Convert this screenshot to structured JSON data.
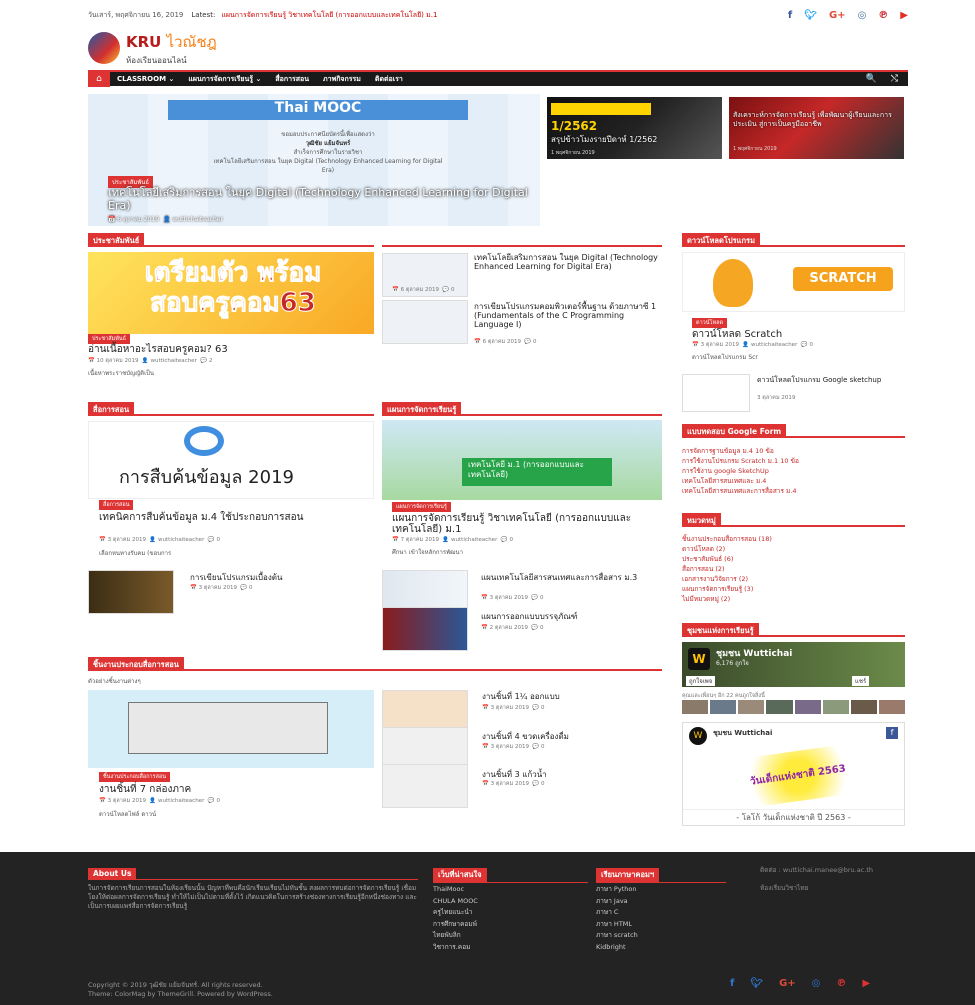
{
  "topbar": {
    "date": "วันเสาร์, พฤศจิกายน 16, 2019",
    "latest_label": "Latest:",
    "latest_text": "แผนการจัดการเรียนรู้ วิชาเทคโนโลยี (การออกแบบและเทคโนโลยี) ม.1",
    "social": [
      "f",
      "t",
      "G+",
      "ig",
      "p",
      "yt"
    ]
  },
  "logo": {
    "kru": "KRU",
    "script": "ไวณัชฎ",
    "sub": "ห้องเรียนออนไลน์"
  },
  "nav": {
    "items": [
      "CLASSROOM ⌄",
      "แผนการจัดการเรียนรู้ ⌄",
      "สื่อการสอน",
      "ภาพกิจกรรม",
      "ติดต่อเรา"
    ],
    "search": "🔍",
    "random": "⤭"
  },
  "featured": {
    "banner": "Thai MOOC",
    "lines": [
      "ขอมอบประกาศนียบัตรนี้เพื่อแสดงว่า",
      "วุฒิชัย แย้มจันทร์",
      "สำเร็จการศึกษาในรายวิชา",
      "เทคโนโลยีเสริมการสอน ในยุค Digital (Technology Enhanced Learning for Digital Era)"
    ],
    "cat": "ประชาสัมพันธ์",
    "title": "เทคโนโลยีเสริมการสอน ในยุค Digital (Technology Enhanced Learning for Digital Era)",
    "date": "6 ตุลาคม 2019",
    "author": "wuttichaiteacher"
  },
  "featured_small": [
    {
      "title": "สรุปข้าวโมงรายปีดาห์ 1/2562",
      "date": "1 พฤศจิกายน 2019"
    },
    {
      "title": "สังเคราะห์การจัดการเรียนรู้ เพื่อพัฒนาผู้เรียนและการประเมิน สู่การเป็นครูมืออาชีพ",
      "date": "1 พฤศจิกายน 2019"
    }
  ],
  "sections": {
    "pr": {
      "title": "ประชาสัมพันธ์",
      "main": {
        "img_text": "เตรียมตัว พร้อม สอบครูคอม63",
        "cat": "ประชาสัมพันธ์",
        "title": "อ่านเนื้อหาอะไรสอบครูคอม? 63",
        "date": "10 ตุลาคม 2019",
        "author": "wuttichaiteacher",
        "comments": "2",
        "excerpt": "เนื้อหาพระราชบัญญัติเป็น"
      },
      "list": [
        {
          "title": "เทคโนโลยีเสริมการสอน ในยุค Digital (Technology Enhanced Learning for Digital Era)",
          "date": "6 ตุลาคม 2019",
          "c": "0"
        },
        {
          "title": "การเขียนโปรแกรมคอมพิวเตอร์พื้นฐาน ด้วยภาษาซี 1 (Fundamentals of the C Programming Language I)",
          "date": "6 ตุลาคม 2019",
          "c": "0"
        }
      ]
    },
    "media": {
      "title": "สื่อการสอน",
      "main": {
        "img_text": "การสืบค้นข้อมูล 2019",
        "cat": "สื่อการสอน",
        "title": "เทคนิคการสืบค้นข้อมูล ม.4 ใช้ประกอบการสอน",
        "date": "3 ตุลาคม 2019",
        "author": "wuttichaiteacher",
        "comments": "0",
        "excerpt": "เลือกหนทางรับคม (ขอบการ"
      },
      "list": [
        {
          "title": "การเขียนโปรแกรมเบื้องต้น",
          "date": "3 ตุลาคม 2019",
          "c": "0"
        }
      ]
    },
    "plan": {
      "title": "แผนการจัดการเรียนรู้",
      "main": {
        "img_text": "เทคโนโลยี ม.1 (การออกแบบและเทคโนโลยี)",
        "cat": "แผนการจัดการเรียนรู้",
        "title": "แผนการจัดการเรียนรู้ วิชาเทคโนโลยี (การออกแบบและเทคโนโลยี) ม.1",
        "date": "7 ตุลาคม 2019",
        "author": "wuttichaiteacher",
        "comments": "0",
        "excerpt": "ศึกษา เข้าใจหลักการพัฒนา"
      },
      "list": [
        {
          "title": "แผนเทคโนโลยีสารสนเทศและการสื่อสาร ม.3",
          "date": "3 ตุลาคม 2019",
          "c": "0"
        },
        {
          "title": "แผนการออกแบบบรรจุภัณฑ์",
          "date": "2 ตุลาคม 2019",
          "c": "0"
        }
      ]
    },
    "works": {
      "title": "ชิ้นงานประกอบสื่อการสอน",
      "intro": "ตัวอย่างชิ้นงานต่างๆ",
      "main": {
        "cat": "ชิ้นงานประกอบสื่อการสอน",
        "title": "งานชิ้นที่ 7 กล่องภาค",
        "date": "3 ตุลาคม 2019",
        "author": "wuttichaiteacher",
        "comments": "0",
        "excerpt": "ดาวน์โหลดไฟล์ ดาวน์"
      },
      "list": [
        {
          "title": "งานชิ้นที่ 1¼ ออกแบบ",
          "date": "3 ตุลาคม 2019",
          "c": "0"
        },
        {
          "title": "งานชิ้นที่ 4 ขวดเครื่องดื่ม",
          "date": "3 ตุลาคม 2019",
          "c": "0"
        },
        {
          "title": "งานชิ้นที่ 3 แก้วน้ำ",
          "date": "3 ตุลาคม 2019",
          "c": "0"
        }
      ]
    }
  },
  "sidebar": {
    "download": {
      "title": "ดาวน์โหลดโปรแกรม",
      "img_text": "SCRATCH",
      "cat": "ดาวน์โหลด",
      "post": "ดาวน์โหลด Scratch",
      "date": "3 ตุลาคม 2019",
      "author": "wuttichaiteacher",
      "comments": "0",
      "excerpt": "ดาวน์โหลดโปรแกรม Scr",
      "item2": "ดาวน์โหลดโปรแกรม Google sketchup",
      "item2_date": "3 ตุลาคม 2019"
    },
    "tests": {
      "title": "แบบทดสอบ Google Form",
      "items": [
        "การจัดการฐานข้อมูล ม.4 10 ข้อ",
        "การใช้งานโปรแกรม Scratch ม.1 10 ข้อ",
        "การใช้งาน google SketchUp",
        "เทคโนโลยีสารสนเทศและ ม.4",
        "เทคโนโลยีสารสนเทศและการสื่อสาร ม.4"
      ]
    },
    "cats": {
      "title": "หมวดหมู่",
      "items": [
        "ชิ้นงานประกอบสื่อการสอน (18)",
        "ดาวน์โหลด (2)",
        "ประชาสัมพันธ์ (6)",
        "สื่อการสอน (2)",
        "เอกสารงานวิจัยการ (2)",
        "แผนการจัดการเรียนรู้ (3)",
        "ไม่มีหมวดหมู่ (2)"
      ]
    },
    "community": {
      "title": "ชุมชนแห่งการเรียนรู้",
      "fb_name": "ชุมชน Wuttichai",
      "fb_sub": "6,176 ถูกใจ",
      "fb_like": "ถูกใจเพจ",
      "fb_share": "แชร์",
      "friends": "คุณและเพื่อนๆ อีก 22 คนถูกใจสิ่งนี้",
      "page2": "ชุมชน Wuttichai",
      "poster_text": "วันเด็กแห่งชาติ 2563",
      "poster_caption": "- โลโก้ วันเด็กแห่งชาติ ปี 2563 -"
    }
  },
  "footer": {
    "about_title": "About Us",
    "about_text": "ในการจัดการเรียนการสอนในห้องเรียนนั้น ปัญหาที่พบคือนักเรียนเรียนไม่ทันชั้น สงผลการทบต่อการจัดการเรียนรู้ เชื่อมโยงให้ต่อผลการจัดการเรียนรู้ ทำให้ไม่เป็นไปตามที่ตั้งไว้ เกิดแนวคิดในการสร้างช่องทางการเรียนรู้อีกหนึ่งช่องทาง และเป็นการเผยแพร่สื่อการจัดการเรียนรู้",
    "links_title": "เว็บที่น่าสนใจ",
    "links": [
      "ThaiMooc",
      "CHULA MOOC",
      "ครูไทยแนะนำ",
      "การศึกษาคอมพ์",
      "ไทยพับลิก",
      "วิชาการ.คอม"
    ],
    "lang_title": "เรียนภาษาคอมฯ",
    "langs": [
      "ภาษา Python",
      "ภาษา Java",
      "ภาษา C",
      "ภาษา HTML",
      "ภาษา scratch",
      "Kidbright"
    ],
    "contact": "ติดต่อ : wuttichai.manee@bru.ac.th",
    "contact2": "ห้องเรียนวิชาไทย",
    "copyright": "Copyright © 2019 วุฒิชัย แย้มจันทร์. All rights reserved.",
    "theme": "Theme: ColorMag by ThemeGrill. Powered by WordPress."
  }
}
